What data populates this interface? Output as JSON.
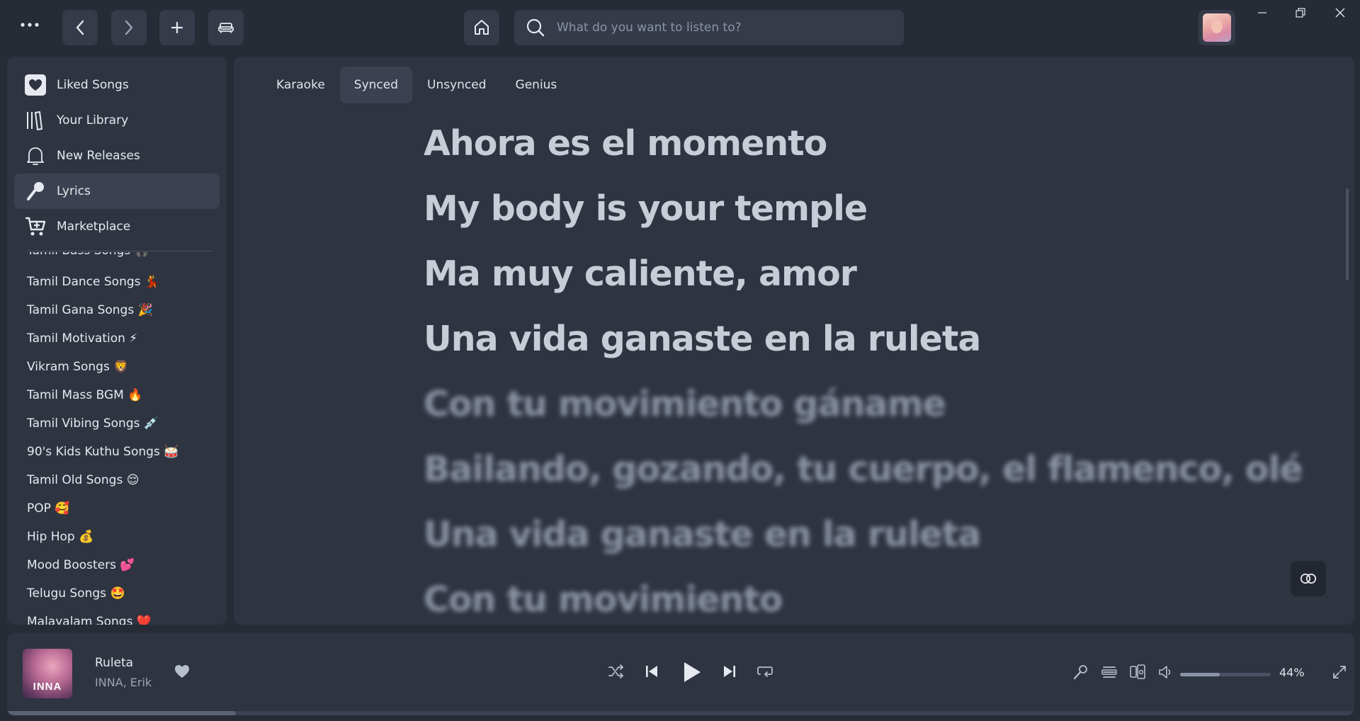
{
  "search": {
    "placeholder": "What do you want to listen to?"
  },
  "sidebar": {
    "nav": [
      {
        "label": "Liked Songs",
        "icon": "heart-square-icon"
      },
      {
        "label": "Your Library",
        "icon": "library-icon"
      },
      {
        "label": "New Releases",
        "icon": "bell-icon"
      },
      {
        "label": "Lyrics",
        "icon": "microphone-icon",
        "active": true
      },
      {
        "label": "Marketplace",
        "icon": "cart-icon"
      }
    ],
    "playlists": [
      "Tamil Bass Songs 🎧",
      "Tamil Dance Songs 💃",
      "Tamil Gana Songs 🎉",
      "Tamil Motivation ⚡",
      "Vikram Songs 🦁",
      "Tamil Mass BGM 🔥",
      "Tamil Vibing Songs 💉",
      "90's Kids Kuthu Songs 🥁",
      "Tamil Old Songs 😌",
      "POP 🥰",
      "Hip Hop 💰",
      "Mood Boosters 💕",
      "Telugu Songs 🤩",
      "Malayalam Songs ❤️"
    ]
  },
  "lyrics": {
    "tabs": [
      "Karaoke",
      "Synced",
      "Unsynced",
      "Genius"
    ],
    "active_tab": "Synced",
    "lines": [
      "Ahora es el momento",
      "My body is your temple",
      "Ma muy caliente, amor",
      "Una vida ganaste en la ruleta",
      "Con tu movimiento gáname",
      "Bailando, gozando, tu cuerpo, el flamenco, olé",
      "Una vida ganaste en la ruleta",
      "Con tu movimiento"
    ],
    "blurred_from_line": 4
  },
  "player": {
    "cover_text": "INNA",
    "title": "Ruleta",
    "artist": "INNA, Erik",
    "volume_label": "44%",
    "volume": 0.44,
    "progress": 0.17
  },
  "colors": {
    "background": "#262b36",
    "panel": "#2f3441",
    "button": "#353b49",
    "active": "#3b4150",
    "text": "#e6e9ef",
    "muted": "#9aa3b5"
  }
}
